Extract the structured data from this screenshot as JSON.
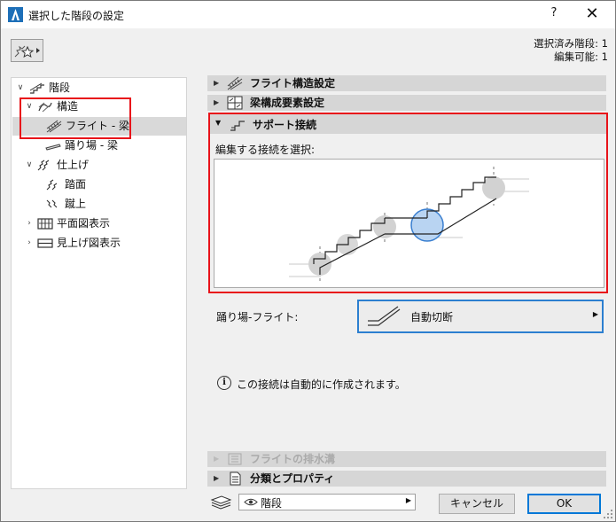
{
  "window": {
    "title": "選択した階段の設定",
    "help_label": "?",
    "close_label": "✕"
  },
  "selection_info": {
    "selected": "選択済み階段: 1",
    "editable": "編集可能: 1"
  },
  "tree": {
    "items": [
      {
        "label": "階段",
        "icon": "stair-icon",
        "expanded": true
      },
      {
        "label": "構造",
        "icon": "structure-icon",
        "expanded": true
      },
      {
        "label": "フライト - 梁",
        "icon": "flight-beam-icon",
        "selected": true
      },
      {
        "label": "踊り場 - 梁",
        "icon": "landing-beam-icon"
      },
      {
        "label": "仕上げ",
        "icon": "finish-icon",
        "expanded": true
      },
      {
        "label": "踏面",
        "icon": "tread-icon"
      },
      {
        "label": "蹴上",
        "icon": "riser-icon"
      },
      {
        "label": "平面図表示",
        "icon": "floor-plan-icon",
        "expanded": false
      },
      {
        "label": "見上げ図表示",
        "icon": "ceiling-plan-icon",
        "expanded": false
      }
    ]
  },
  "sections": {
    "flight_structure": {
      "label": "フライト構造設定",
      "icon": "flight-structure-icon"
    },
    "beam_elements": {
      "label": "梁構成要素設定",
      "icon": "beam-elements-icon"
    },
    "support_connection": {
      "label": "サポート接続",
      "icon": "support-connection-icon"
    },
    "flight_drainage": {
      "label": "フライトの排水溝",
      "icon": "drainage-icon",
      "disabled": true
    },
    "classification": {
      "label": "分類とプロパティ",
      "icon": "classification-icon"
    }
  },
  "support": {
    "select_label": "編集する接続を選択:"
  },
  "landing_flight": {
    "label": "踊り場-フライト:",
    "value": "自動切断",
    "icon": "auto-cut-icon"
  },
  "info": {
    "text": "この接続は自動的に作成されます。"
  },
  "footer": {
    "layer_value": "階段",
    "cancel_label": "キャンセル",
    "ok_label": "OK"
  },
  "colors": {
    "highlight_red": "#e8131a",
    "accent_blue": "#2c7fd0",
    "selected_joint": "#b9d4f2"
  }
}
